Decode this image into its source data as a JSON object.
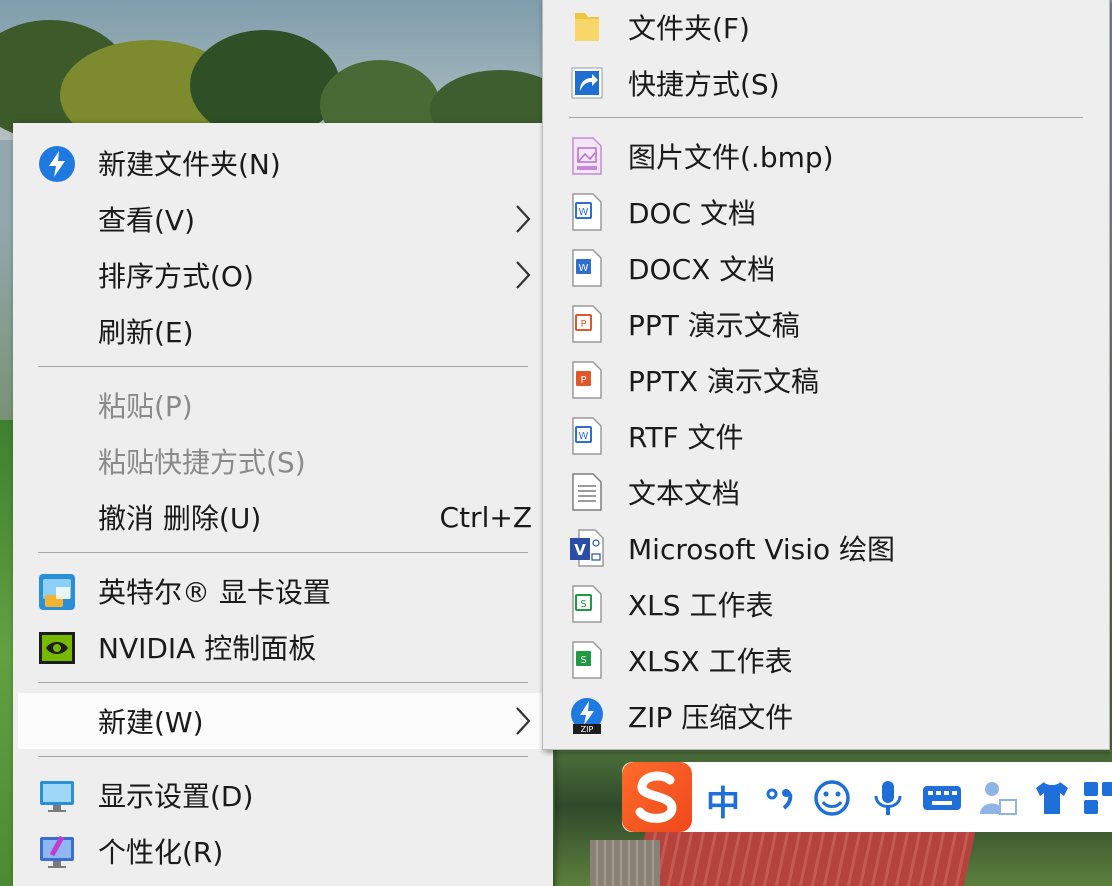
{
  "main_menu": {
    "items": [
      {
        "label": "新建文件夹(N)",
        "icon": "new-folder-quick-icon",
        "submenu": false,
        "disabled": false
      },
      {
        "label": "查看(V)",
        "submenu": true,
        "disabled": false
      },
      {
        "label": "排序方式(O)",
        "submenu": true,
        "disabled": false
      },
      {
        "label": "刷新(E)",
        "submenu": false,
        "disabled": false
      },
      {
        "label": "粘贴(P)",
        "submenu": false,
        "disabled": true
      },
      {
        "label": "粘贴快捷方式(S)",
        "submenu": false,
        "disabled": true
      },
      {
        "label": "撤消 删除(U)",
        "shortcut": "Ctrl+Z",
        "submenu": false,
        "disabled": false
      },
      {
        "label": "英特尔® 显卡设置",
        "icon": "intel-graphics-icon",
        "submenu": false,
        "disabled": false
      },
      {
        "label": "NVIDIA 控制面板",
        "icon": "nvidia-icon",
        "submenu": false,
        "disabled": false
      },
      {
        "label": "新建(W)",
        "submenu": true,
        "disabled": false,
        "highlighted": true
      },
      {
        "label": "显示设置(D)",
        "icon": "display-settings-icon",
        "submenu": false,
        "disabled": false
      },
      {
        "label": "个性化(R)",
        "icon": "personalize-icon",
        "submenu": false,
        "disabled": false
      }
    ]
  },
  "sub_menu": {
    "items": [
      {
        "label": "文件夹(F)",
        "icon": "folder-icon"
      },
      {
        "label": "快捷方式(S)",
        "icon": "shortcut-icon"
      },
      {
        "label": "图片文件(.bmp)",
        "icon": "bmp-file-icon"
      },
      {
        "label": "DOC 文档",
        "icon": "doc-file-icon"
      },
      {
        "label": "DOCX 文档",
        "icon": "docx-file-icon"
      },
      {
        "label": "PPT 演示文稿",
        "icon": "ppt-file-icon"
      },
      {
        "label": "PPTX 演示文稿",
        "icon": "pptx-file-icon"
      },
      {
        "label": "RTF 文件",
        "icon": "rtf-file-icon"
      },
      {
        "label": "文本文档",
        "icon": "text-file-icon"
      },
      {
        "label": "Microsoft Visio 绘图",
        "icon": "visio-file-icon"
      },
      {
        "label": "XLS 工作表",
        "icon": "xls-file-icon"
      },
      {
        "label": "XLSX 工作表",
        "icon": "xlsx-file-icon"
      },
      {
        "label": "ZIP 压缩文件",
        "icon": "zip-file-icon"
      }
    ]
  },
  "ime_bar": {
    "mode_label": "中",
    "icons": [
      "sogou-logo-icon",
      "punctuation-icon",
      "emoji-icon",
      "microphone-icon",
      "keyboard-icon",
      "user-tools-icon",
      "skin-shirt-icon",
      "grid-menu-icon"
    ]
  },
  "colors": {
    "menu_bg": "#eeeeee",
    "highlight_bg": "#fcfcfc",
    "disabled_text": "#8a8a8a",
    "word_blue": "#2f6fd1",
    "ppt_orange": "#e2572a",
    "excel_green": "#1f9a43"
  }
}
